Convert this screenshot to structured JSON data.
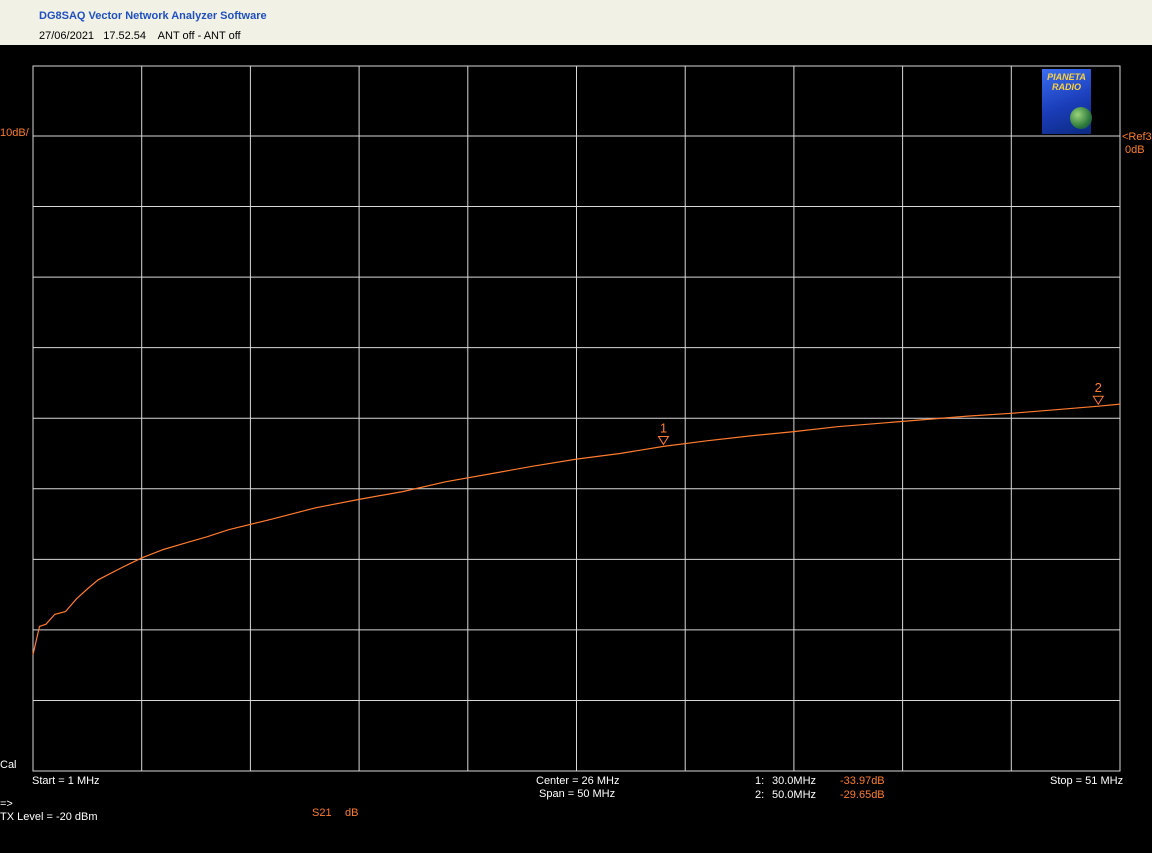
{
  "header": {
    "title": "DG8SAQ Vector Network Analyzer Software",
    "subtitle": "27/06/2021   17.52.54    ANT off - ANT off"
  },
  "logo": {
    "line1": "PIANETA",
    "line2": "RADIO"
  },
  "scale": {
    "per_div": "10dB/",
    "ref_line1": "<Ref3",
    "ref_line2": "0dB",
    "cal": "Cal"
  },
  "footer": {
    "start": "Start = 1 MHz",
    "center": "Center = 26 MHz",
    "span": "Span = 50 MHz",
    "stop": "Stop = 51 MHz",
    "arrow": "=>",
    "tx_level": "TX Level = -20 dBm",
    "trace_param": "S21",
    "trace_unit": "dB"
  },
  "markers": [
    {
      "id": "1",
      "label": "1:",
      "freq": "30.0MHz",
      "value": "-33.97dB"
    },
    {
      "id": "2",
      "label": "2:",
      "freq": "50.0MHz",
      "value": "-29.65dB"
    }
  ],
  "colors": {
    "trace": "#ff7b2e",
    "grid": "#d8d8d8",
    "background": "#000000",
    "header": "#f2f1e6"
  },
  "chart_data": {
    "type": "line",
    "xlabel": "",
    "ylabel": "",
    "xlim": [
      1,
      51
    ],
    "ylim": [
      -100,
      0
    ],
    "ref_level": 0,
    "grid": true,
    "series": [
      {
        "name": "S21",
        "x": [
          1,
          1.3,
          1.6,
          2,
          2.5,
          3,
          3.5,
          4,
          5,
          6,
          7,
          8,
          9,
          10,
          12,
          14,
          16,
          18,
          20,
          22,
          24,
          26,
          28,
          30,
          32,
          34,
          36,
          38,
          40,
          42,
          44,
          46,
          48,
          50,
          51
        ],
        "y": [
          -73.5,
          -69.5,
          -69.2,
          -67.8,
          -67.4,
          -65.6,
          -64.2,
          -62.9,
          -61.3,
          -59.8,
          -58.6,
          -57.7,
          -56.8,
          -55.8,
          -54.3,
          -52.7,
          -51.5,
          -50.4,
          -49.0,
          -47.9,
          -46.8,
          -45.8,
          -45.0,
          -44.0,
          -43.2,
          -42.5,
          -41.9,
          -41.2,
          -40.7,
          -40.2,
          -39.7,
          -39.3,
          -38.8,
          -38.3,
          -38.0
        ]
      }
    ],
    "markers": [
      {
        "id": "1",
        "x": 30,
        "y": -33.97
      },
      {
        "id": "2",
        "x": 50,
        "y": -29.65
      }
    ]
  }
}
